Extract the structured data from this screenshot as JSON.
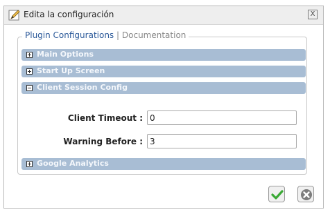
{
  "dialog": {
    "title": "Edita la configuración",
    "close_glyph": "X"
  },
  "tabs": {
    "active": "Plugin Configurations",
    "separator": "|",
    "other": "Documentation"
  },
  "sections": [
    {
      "label": "Main Options",
      "state": "+"
    },
    {
      "label": "Start Up Screen",
      "state": "+"
    },
    {
      "label": "Client Session Config",
      "state": "-"
    },
    {
      "label": "Google Analytics",
      "state": "+"
    }
  ],
  "fields": {
    "client_timeout": {
      "label": "Client Timeout :",
      "value": "0"
    },
    "warning_before": {
      "label": "Warning Before :",
      "value": "3"
    }
  },
  "icons": {
    "title": "edit-pencil-icon",
    "confirm": "checkmark-icon",
    "cancel": "cancel-icon"
  },
  "colors": {
    "accordion_header": "#a8bdd4",
    "tab_active": "#2c5a9a",
    "confirm_green": "#3aa935",
    "cancel_gray": "#7d7d7d"
  }
}
